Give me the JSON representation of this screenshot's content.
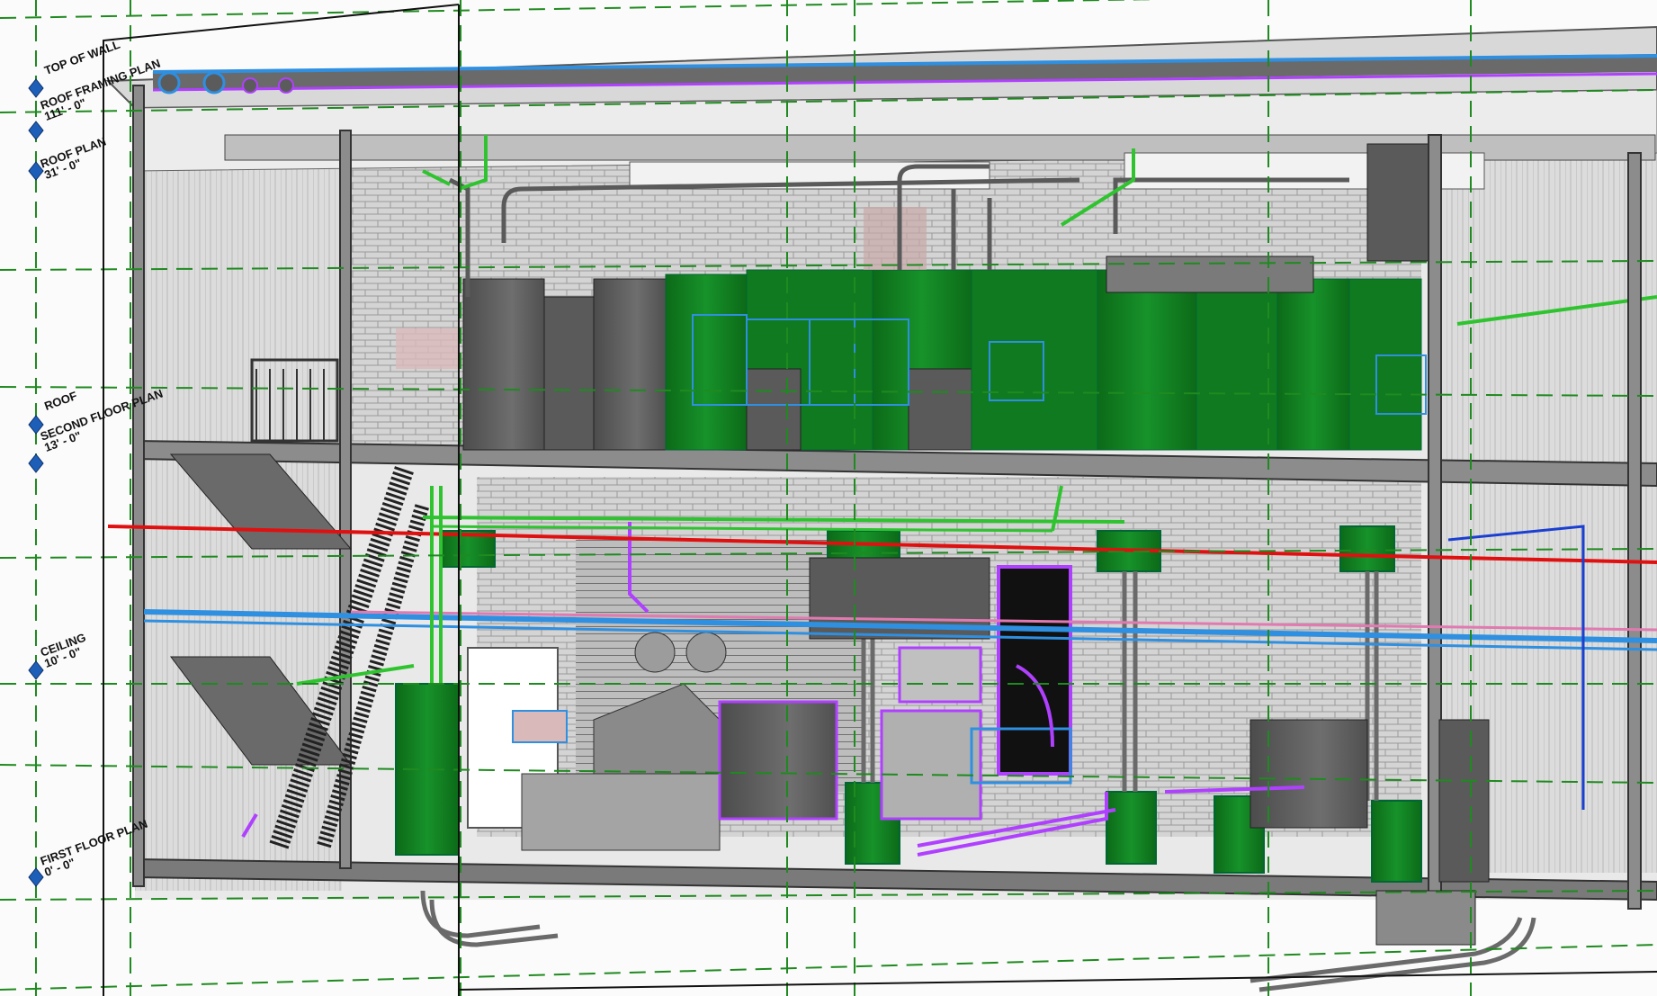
{
  "view": {
    "type": "Revit 3D section view",
    "colors": {
      "grid_line": "#1f8a1f",
      "equipment_green": "#0f7a1f",
      "equipment_dark_green": "#0a5c16",
      "equipment_grey": "#5a5a5a",
      "duct_blue": "#2f8fe0",
      "pipe_purple": "#b040ff",
      "pipe_red": "#e01010",
      "pipe_pink": "#e07ab0",
      "structure_grey": "#8c8c8c",
      "level_marker_blue": "#1d5fb8"
    }
  },
  "levels": [
    {
      "id": "top-of-wall",
      "name": "TOP OF WALL",
      "elevation": ""
    },
    {
      "id": "roof-framing-plan",
      "name": "ROOF FRAMING PLAN",
      "elevation": "111' - 0\""
    },
    {
      "id": "roof-plan",
      "name": "ROOF PLAN",
      "elevation": "31' - 0\""
    },
    {
      "id": "roof",
      "name": "ROOF",
      "elevation": ""
    },
    {
      "id": "second-floor-plan",
      "name": "SECOND FLOOR PLAN",
      "elevation": "13' - 0\""
    },
    {
      "id": "ceiling",
      "name": "CEILING",
      "elevation": "10' - 0\""
    },
    {
      "id": "first-floor-plan",
      "name": "FIRST FLOOR PLAN",
      "elevation": "0' - 0\""
    }
  ]
}
